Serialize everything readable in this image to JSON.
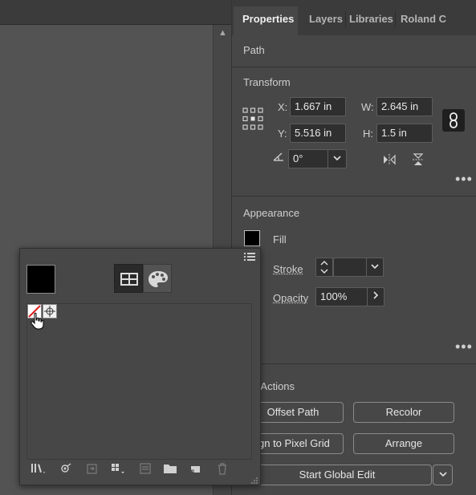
{
  "panel": {
    "tabs": [
      {
        "label": "Properties",
        "active": true
      },
      {
        "label": "Layers"
      },
      {
        "label": "Libraries"
      },
      {
        "label": "Roland C"
      }
    ],
    "object_type": "Path",
    "transform": {
      "title": "Transform",
      "x_label": "X:",
      "x_value": "1.667 in",
      "y_label": "Y:",
      "y_value": "5.516 in",
      "w_label": "W:",
      "w_value": "2.645 in",
      "h_label": "H:",
      "h_value": "1.5 in",
      "angle_value": "0°"
    },
    "appearance": {
      "title": "Appearance",
      "fill_label": "Fill",
      "stroke_label": "Stroke",
      "opacity_label": "Opacity",
      "opacity_value": "100%",
      "fill_color": "#000000"
    },
    "quick_actions": {
      "title": "k Actions",
      "offset_path": "Offset Path",
      "recolor": "Recolor",
      "align_pixel": "ign to Pixel Grid",
      "arrange": "Arrange",
      "start_global_edit": "Start Global Edit"
    }
  },
  "popover": {
    "fill_color": "#000000",
    "icons": [
      "swatch-libraries-icon",
      "swatch-kinds-icon",
      "swatch-options-icon",
      "new-color-group-icon",
      "edit-swatch-icon",
      "new-folder-icon",
      "new-swatch-icon",
      "delete-swatch-icon"
    ]
  },
  "colors": {
    "panel_bg": "#474747",
    "canvas_bg": "#535353",
    "tabbar_bg": "#3b3b3b",
    "field_bg": "#2f2f2f"
  }
}
